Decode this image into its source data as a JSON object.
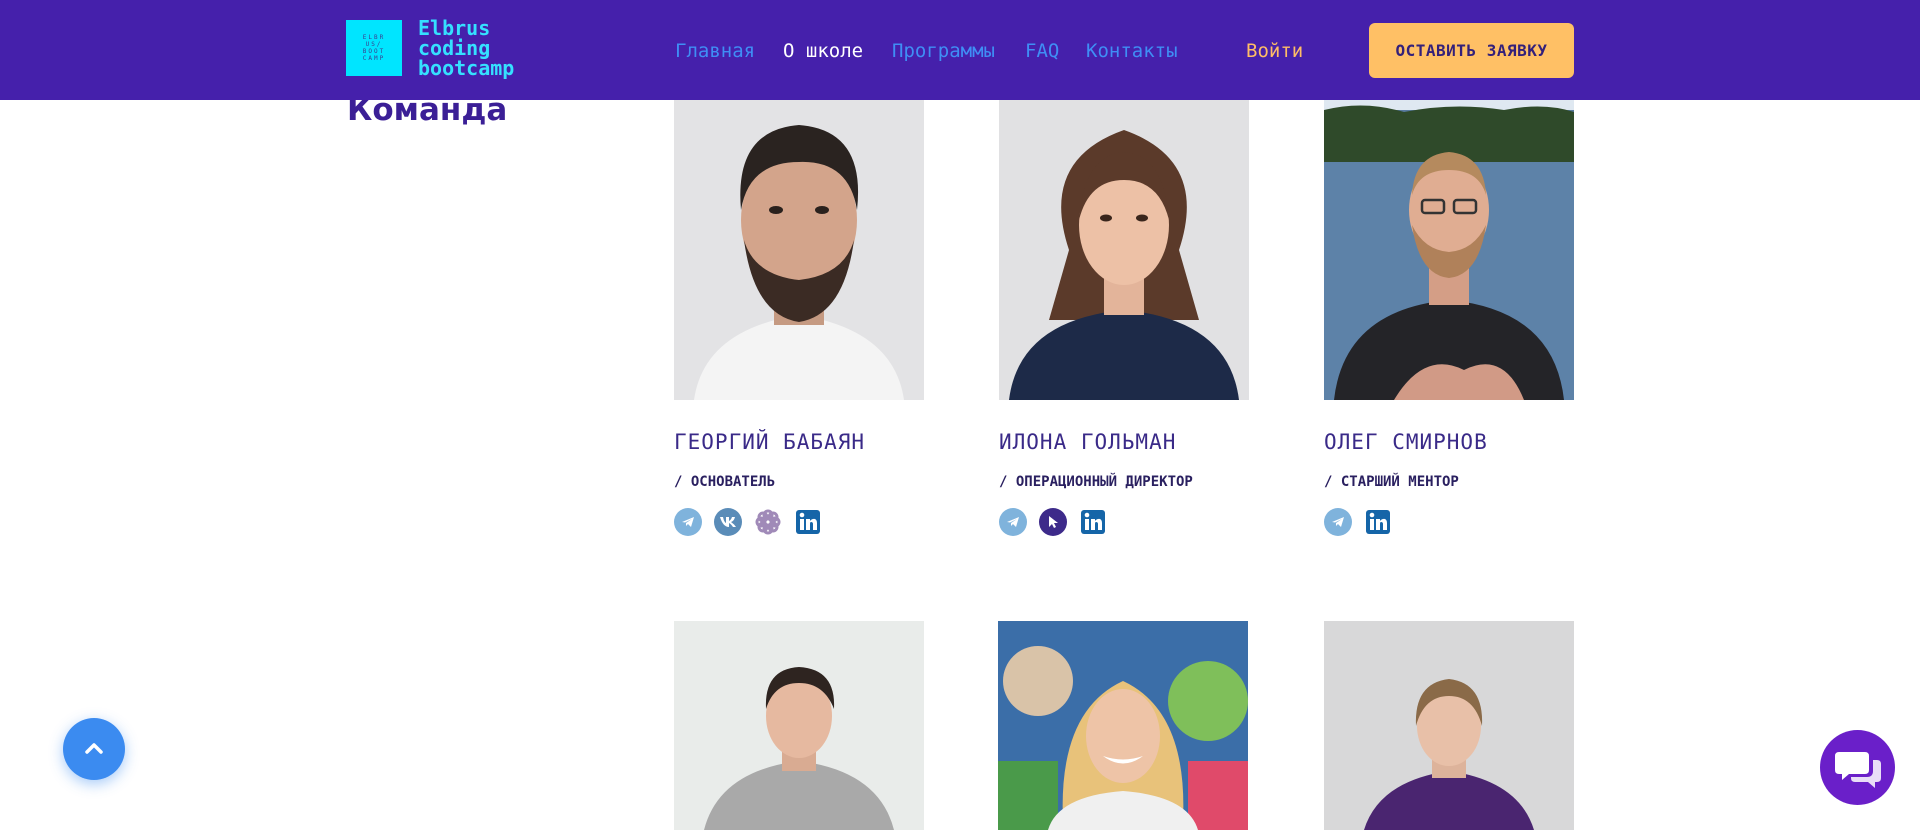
{
  "header": {
    "logo_box_text": "ELBR\nUS/\nBOOT\nCAMP",
    "logo_text": "Elbrus\ncoding\nbootcamp",
    "nav": [
      {
        "label": "Главная",
        "active": false
      },
      {
        "label": "О школе",
        "active": true
      },
      {
        "label": "Программы",
        "active": false
      },
      {
        "label": "FAQ",
        "active": false
      },
      {
        "label": "Контакты",
        "active": false
      }
    ],
    "login_label": "Войти",
    "cta_label": "ОСТАВИТЬ ЗАЯВКУ"
  },
  "section": {
    "title": "Команда"
  },
  "team": [
    {
      "name": "ГЕОРГИЙ БАБАЯН",
      "role": "/ ОСНОВАТЕЛЬ",
      "socials": [
        "telegram-icon",
        "vk-icon",
        "flower-icon",
        "linkedin-icon"
      ]
    },
    {
      "name": "ИЛОНА ГОЛЬМАН",
      "role": "/ ОПЕРАЦИОННЫЙ ДИРЕКТОР",
      "socials": [
        "telegram-icon",
        "cursor-icon",
        "linkedin-icon"
      ]
    },
    {
      "name": "ОЛЕГ СМИРНОВ",
      "role": "/ СТАРШИЙ МЕНТОР",
      "socials": [
        "telegram-icon",
        "linkedin-icon"
      ]
    }
  ],
  "colors": {
    "header_bg": "#4520ab",
    "accent_cyan": "#00e5ff",
    "nav_link": "#3f8ef5",
    "cta_bg": "#ffc065",
    "title": "#3b1f96",
    "scroll_button": "#3b8bf0",
    "chat_button": "#6a1fc9"
  },
  "floating": {
    "scroll_top_icon": "chevron-up-icon",
    "chat_icon": "chat-bubbles-icon"
  }
}
